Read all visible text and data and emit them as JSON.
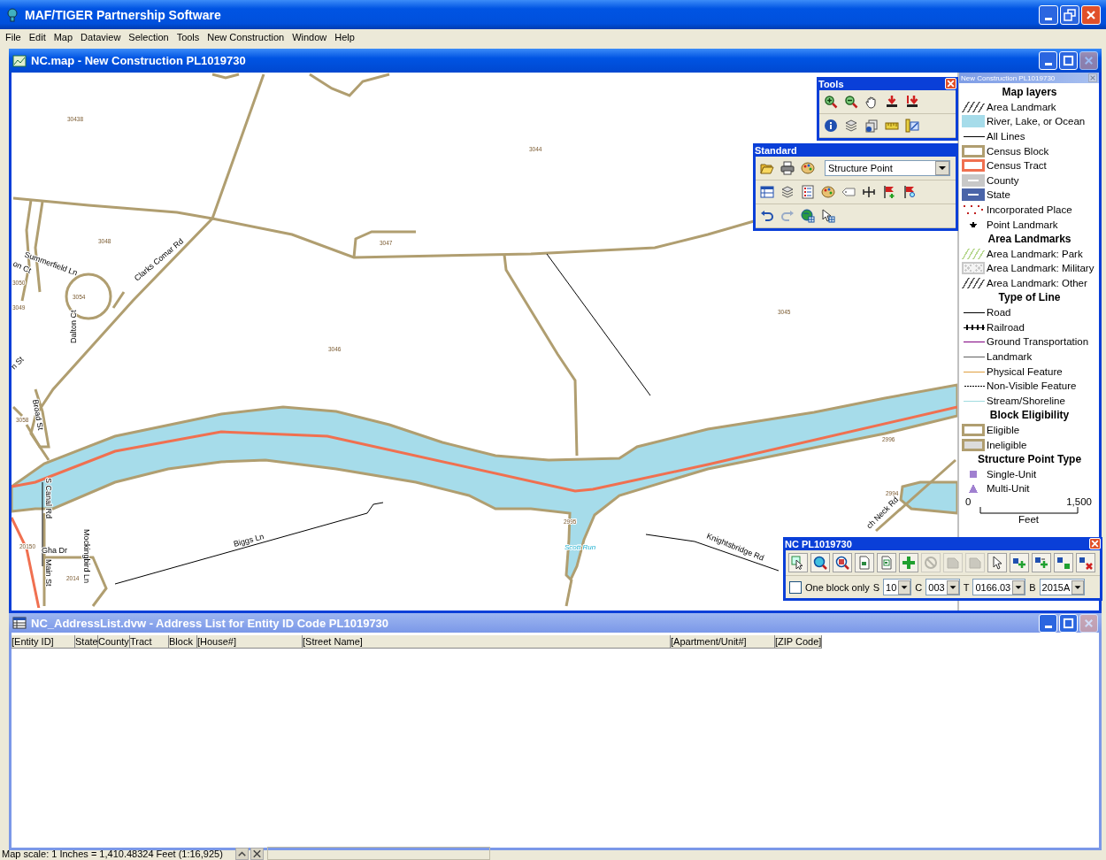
{
  "app": {
    "title": "MAF/TIGER Partnership Software",
    "controls": [
      {
        "kind": "minimize",
        "disabled": false
      },
      {
        "kind": "restore",
        "disabled": false
      },
      {
        "kind": "close",
        "disabled": false
      }
    ]
  },
  "menu": [
    "File",
    "Edit",
    "Map",
    "Dataview",
    "Selection",
    "Tools",
    "New Construction",
    "Window",
    "Help"
  ],
  "map_window": {
    "title": "NC.map - New Construction  PL1019730",
    "controls": [
      {
        "kind": "minimize",
        "disabled": false
      },
      {
        "kind": "maximize",
        "disabled": false
      },
      {
        "kind": "close",
        "disabled": true
      }
    ]
  },
  "map_labels": [
    {
      "text": "30438",
      "kind": "block"
    },
    {
      "text": "3044",
      "kind": "block"
    },
    {
      "text": "3048",
      "kind": "block"
    },
    {
      "text": "3047",
      "kind": "block"
    },
    {
      "text": "3046",
      "kind": "block"
    },
    {
      "text": "3045",
      "kind": "block"
    },
    {
      "text": "3054",
      "kind": "block"
    },
    {
      "text": "3050",
      "kind": "block"
    },
    {
      "text": "3049",
      "kind": "block"
    },
    {
      "text": "3058",
      "kind": "block"
    },
    {
      "text": "2996",
      "kind": "block"
    },
    {
      "text": "2994",
      "kind": "block"
    },
    {
      "text": "2995",
      "kind": "block"
    },
    {
      "text": "20150",
      "kind": "block"
    },
    {
      "text": "2014",
      "kind": "block"
    },
    {
      "text": "Clarks Comar Rd",
      "kind": "street"
    },
    {
      "text": "Summerfield Ln",
      "kind": "street"
    },
    {
      "text": "on Ct",
      "kind": "street"
    },
    {
      "text": "Dalton Ct",
      "kind": "street"
    },
    {
      "text": "n St",
      "kind": "street"
    },
    {
      "text": "Broad St",
      "kind": "street"
    },
    {
      "text": "S Canal Rd",
      "kind": "street"
    },
    {
      "text": "Gha Dr",
      "kind": "street"
    },
    {
      "text": "Mockingbird Ln",
      "kind": "street"
    },
    {
      "text": "Main St",
      "kind": "street"
    },
    {
      "text": "Biggs Ln",
      "kind": "street"
    },
    {
      "text": "Knightsbridge Rd",
      "kind": "street"
    },
    {
      "text": "ch Neck Rd",
      "kind": "street"
    },
    {
      "text": "Scott Run",
      "kind": "water"
    }
  ],
  "tools_toolbar": {
    "title": "Tools",
    "rows": [
      [
        {
          "kind": "zoom-in",
          "disabled": false
        },
        {
          "kind": "zoom-out",
          "disabled": false
        },
        {
          "kind": "hand",
          "disabled": false
        },
        {
          "kind": "arrow-down",
          "disabled": false
        },
        {
          "kind": "arrow-bar",
          "disabled": false
        }
      ],
      [
        {
          "kind": "info",
          "disabled": false
        },
        {
          "kind": "layers",
          "disabled": false
        },
        {
          "kind": "pages",
          "disabled": false
        },
        {
          "kind": "ruler",
          "disabled": false
        },
        {
          "kind": "measure",
          "disabled": false
        }
      ]
    ]
  },
  "standard_toolbar": {
    "title": "Standard",
    "dropdown": "Structure Point",
    "rows": [
      [
        {
          "kind": "folder",
          "disabled": false
        },
        {
          "kind": "printer",
          "disabled": false
        },
        {
          "kind": "palette",
          "disabled": false
        }
      ],
      [
        {
          "kind": "table",
          "disabled": false
        },
        {
          "kind": "layers",
          "disabled": false
        },
        {
          "kind": "list",
          "disabled": false
        },
        {
          "kind": "palette",
          "disabled": false
        },
        {
          "kind": "tag",
          "disabled": false
        },
        {
          "kind": "scale",
          "disabled": false
        },
        {
          "kind": "flag-plus",
          "disabled": false
        },
        {
          "kind": "flag-search",
          "disabled": false
        }
      ],
      [
        {
          "kind": "undo",
          "disabled": false
        },
        {
          "kind": "redo",
          "disabled": true
        },
        {
          "kind": "globe-grid",
          "disabled": false
        },
        {
          "kind": "cursor-grid",
          "disabled": false
        }
      ]
    ]
  },
  "legend": {
    "title": "New Construction  PL1019730",
    "close_disabled": true,
    "items": [
      {
        "kind": "heading",
        "label": "Map layers"
      },
      {
        "kind": "hatch",
        "label": "Area Landmark",
        "color": "#555555"
      },
      {
        "kind": "fill",
        "label": "River, Lake, or Ocean",
        "color": "#a6dcea"
      },
      {
        "kind": "line",
        "label": "All Lines",
        "color": "#000000"
      },
      {
        "kind": "box",
        "label": "Census Block",
        "color": "#b09e70"
      },
      {
        "kind": "box",
        "label": "Census Tract",
        "color": "#f07050"
      },
      {
        "kind": "bar",
        "label": "County",
        "color": "#c8c8c8"
      },
      {
        "kind": "bar",
        "label": "State",
        "color": "#4a64a8"
      },
      {
        "kind": "dots",
        "label": "Incorporated Place",
        "color": "#c02020"
      },
      {
        "kind": "star",
        "label": "Point Landmark",
        "color": "#000000"
      },
      {
        "kind": "heading",
        "label": "Area Landmarks"
      },
      {
        "kind": "hatch",
        "label": "Area Landmark: Park",
        "color": "#b8d890"
      },
      {
        "kind": "crosshatch",
        "label": "Area Landmark: Military",
        "color": "#c8c8c8"
      },
      {
        "kind": "hatch",
        "label": "Area Landmark: Other",
        "color": "#555555"
      },
      {
        "kind": "heading",
        "label": "Type of Line"
      },
      {
        "kind": "line",
        "label": "Road",
        "color": "#000000"
      },
      {
        "kind": "railroad",
        "label": "Railroad",
        "color": "#000000"
      },
      {
        "kind": "line",
        "label": "Ground Transportation",
        "color": "#800080"
      },
      {
        "kind": "line",
        "label": "Landmark",
        "color": "#606060"
      },
      {
        "kind": "line",
        "label": "Physical Feature",
        "color": "#e0a040"
      },
      {
        "kind": "dotted",
        "label": "Non-Visible Feature",
        "color": "#000000"
      },
      {
        "kind": "line",
        "label": "Stream/Shoreline",
        "color": "#a0dce0"
      },
      {
        "kind": "heading",
        "label": "Block Eligibility"
      },
      {
        "kind": "box",
        "label": "Eligible",
        "color": "#b09e70"
      },
      {
        "kind": "box-shaded",
        "label": "Ineligible",
        "color": "#b09e70"
      },
      {
        "kind": "heading",
        "label": "Structure Point Type"
      },
      {
        "kind": "square",
        "label": "Single-Unit",
        "color": "#a080d0"
      },
      {
        "kind": "triangle",
        "label": "Multi-Unit",
        "color": "#a080d0"
      }
    ],
    "scale": {
      "start": "0",
      "end": "1,500",
      "unit": "Feet"
    }
  },
  "nc_panel": {
    "title": "NC PL1019730",
    "tools": [
      {
        "kind": "cursor-select",
        "disabled": false
      },
      {
        "kind": "zoom-map",
        "disabled": false
      },
      {
        "kind": "zoom-grid",
        "disabled": false
      },
      {
        "kind": "page",
        "disabled": false
      },
      {
        "kind": "page-copy",
        "disabled": false
      },
      {
        "kind": "plus",
        "disabled": false
      },
      {
        "kind": "no-sign",
        "disabled": true
      },
      {
        "kind": "shape",
        "disabled": true
      },
      {
        "kind": "shape",
        "disabled": true
      },
      {
        "kind": "cursor",
        "disabled": false
      },
      {
        "kind": "point-plus",
        "disabled": false
      },
      {
        "kind": "point-move",
        "disabled": false
      },
      {
        "kind": "point-add",
        "disabled": false
      },
      {
        "kind": "point-delete",
        "disabled": false
      }
    ],
    "one_block_only": {
      "label": "One block only",
      "checked": false
    },
    "selects": [
      {
        "label": "S",
        "value": "10"
      },
      {
        "label": "C",
        "value": "003"
      },
      {
        "label": "T",
        "value": "0166.03"
      },
      {
        "label": "B",
        "value": "2015A"
      }
    ]
  },
  "list_window": {
    "title": "NC_AddressList.dvw - Address List for Entity ID Code PL1019730",
    "controls": [
      {
        "kind": "minimize",
        "disabled": false
      },
      {
        "kind": "maximize",
        "disabled": false
      },
      {
        "kind": "close",
        "disabled": true
      }
    ],
    "columns": [
      "[Entity ID]",
      "State",
      "County",
      "Tract",
      "Block",
      "[House#]",
      "[Street Name]",
      "[Apartment/Unit#]",
      "[ZIP Code]"
    ]
  },
  "status_bar": {
    "text": "Map scale: 1 Inches = 1,410.48324 Feet (1:16,925)",
    "buttons": [
      {
        "kind": "caret-up"
      },
      {
        "kind": "close-x"
      }
    ]
  }
}
